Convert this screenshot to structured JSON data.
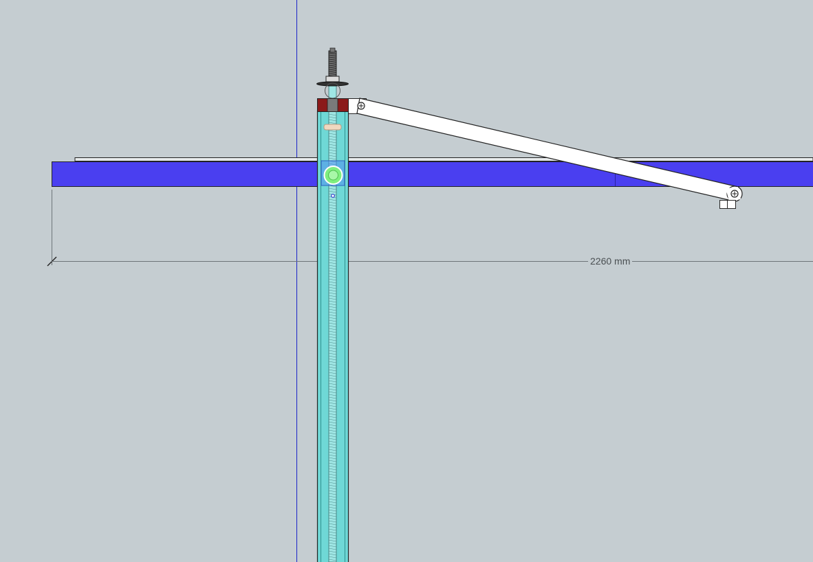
{
  "canvas": {
    "background_color": "#c5cdd1",
    "axis_color": "#1a22c8"
  },
  "dimension": {
    "label": "2260 mm",
    "line_color": "#6e7478"
  },
  "model": {
    "beam_color": "#4a3ff0",
    "post_color": "#6fd8d6",
    "bracket_color": "#8b1a1a",
    "arm_color": "#ffffff",
    "bubble_color": "#7fef7f",
    "highlight_color": "#4f8ff0",
    "cap_color": "#f0d8c0",
    "outline_color": "#222222"
  }
}
